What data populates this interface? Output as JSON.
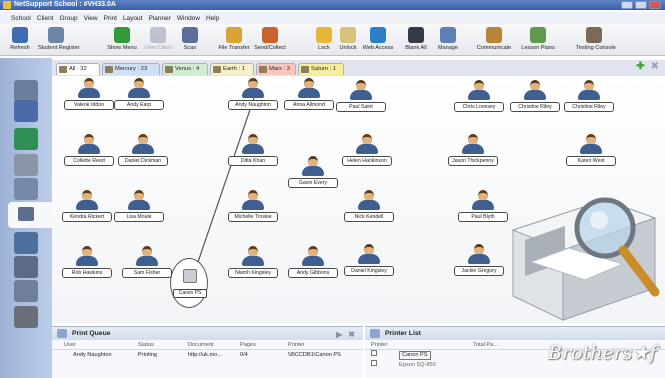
{
  "window": {
    "title": "NetSupport School : #VH33.0A"
  },
  "menu": [
    "School",
    "Client",
    "Group",
    "View",
    "Print",
    "Layout",
    "Planner",
    "Window",
    "Help"
  ],
  "toolbar": [
    {
      "id": "refresh",
      "label": "Refresh",
      "icon": "refresh-icon",
      "color": "#3f6db0",
      "enabled": true
    },
    {
      "id": "student-register",
      "label": "Student Register",
      "icon": "register-icon",
      "color": "#6d86a8",
      "enabled": true
    },
    {
      "id": "show-menu",
      "label": "Show Menu",
      "icon": "play-icon",
      "color": "#2f9b3a",
      "enabled": true
    },
    {
      "id": "view-client",
      "label": "View Client",
      "icon": "monitor-icon",
      "color": "#7c8aa0",
      "enabled": false
    },
    {
      "id": "scan",
      "label": "Scan",
      "icon": "scan-icon",
      "color": "#5a6f98",
      "enabled": true
    },
    {
      "id": "file-transfer",
      "label": "File Transfer",
      "icon": "file-transfer-icon",
      "color": "#d9a33a",
      "enabled": true
    },
    {
      "id": "send-collect",
      "label": "Send/Collect",
      "icon": "send-collect-icon",
      "color": "#c9622d",
      "enabled": true
    },
    {
      "id": "lock",
      "label": "Lock",
      "icon": "lock-icon",
      "color": "#e5b63a",
      "enabled": true
    },
    {
      "id": "unlock",
      "label": "Unlock",
      "icon": "unlock-icon",
      "color": "#d7c27a",
      "enabled": true
    },
    {
      "id": "web-access",
      "label": "Web Access",
      "icon": "globe-icon",
      "color": "#2e7fc9",
      "enabled": true
    },
    {
      "id": "blank-all",
      "label": "Blank All",
      "icon": "blank-screen-icon",
      "color": "#333a48",
      "enabled": true
    },
    {
      "id": "manage",
      "label": "Manage",
      "icon": "manage-icon",
      "color": "#5f7fb8",
      "enabled": true
    },
    {
      "id": "communicate",
      "label": "Communicate",
      "icon": "communicate-icon",
      "color": "#b8863a",
      "enabled": true
    },
    {
      "id": "lesson-plans",
      "label": "Lesson Plans",
      "icon": "lesson-plans-icon",
      "color": "#5d9c4a",
      "enabled": true
    },
    {
      "id": "testing-console",
      "label": "Testing Console",
      "icon": "testing-console-icon",
      "color": "#7a6a58",
      "enabled": true
    }
  ],
  "tabs": [
    {
      "label": "All : 32",
      "color": "#ffffff"
    },
    {
      "label": "Mercury : 23",
      "color": "#cfe0f4"
    },
    {
      "label": "Venus : 4",
      "color": "#cfeed1"
    },
    {
      "label": "Earth : 1",
      "color": "#f7f1c9"
    },
    {
      "label": "Mars : 3",
      "color": "#f8c7bd"
    },
    {
      "label": "Saturn : 1",
      "color": "#f4ef9a"
    }
  ],
  "sidebar": [
    {
      "name": "sidebar-item-students",
      "icon": "students-icon",
      "color": "#6b7e9e"
    },
    {
      "name": "sidebar-item-monitor",
      "icon": "monitor-icon",
      "color": "#4a6aa8"
    },
    {
      "name": "sidebar-item-web",
      "icon": "globe-icon",
      "color": "#2f8f57"
    },
    {
      "name": "sidebar-item-applications",
      "icon": "applications-icon",
      "color": "#8a95a8"
    },
    {
      "name": "sidebar-item-devices",
      "icon": "device-icon",
      "color": "#7888a8"
    },
    {
      "name": "sidebar-item-printing",
      "icon": "printer-icon",
      "color": "#5c6e8c",
      "selected": true
    },
    {
      "name": "sidebar-item-groups",
      "icon": "groups-icon",
      "color": "#4d6f9c"
    },
    {
      "name": "sidebar-item-network",
      "icon": "network-icon",
      "color": "#5c6a86"
    },
    {
      "name": "sidebar-item-disc",
      "icon": "disc-icon",
      "color": "#6f7e99"
    },
    {
      "name": "sidebar-item-security",
      "icon": "security-icon",
      "color": "#6a6f7a"
    }
  ],
  "students": [
    "Valerie Iddon",
    "Andy Earp",
    "Andy Naughton",
    "Anna Allmond",
    "Paul Saint",
    "Chris Lovesey",
    "Christine Riley",
    "Christine Riley",
    "Collette Reed",
    "Daniel Dickman",
    "Ditta Khan",
    "Gavin Every",
    "Helen Hankinson",
    "Jason Thickpenny",
    "Karen West",
    "Kendra Rickert",
    "Lisa Moule",
    "Michelle Troskie",
    "Nick Kendell",
    "Paul Blyth",
    "Rob Hawkins",
    "Sam Fisher",
    "Niamh Kingsley",
    "Andy Gibbons",
    "Daniel Kingsley",
    "Jackie Gregory"
  ],
  "printer_node": {
    "label": "Canon PS"
  },
  "print_queue": {
    "title": "Print Queue",
    "columns": [
      "User",
      "Status",
      "Document",
      "Pages",
      "Printer"
    ],
    "rows": [
      {
        "user": "Andy Naughton",
        "status": "Printing",
        "document": "http://uk.mo...",
        "pages": "0/4",
        "printer": "\\\\BCCDB1\\Canon PS"
      }
    ]
  },
  "printer_list": {
    "title": "Printer List",
    "columns": [
      "Printer",
      "Total Pa..."
    ],
    "rows": [
      {
        "printer": "Canon PS"
      },
      {
        "printer": "Epson SQ-850"
      }
    ]
  },
  "watermark": "Brothers★f"
}
